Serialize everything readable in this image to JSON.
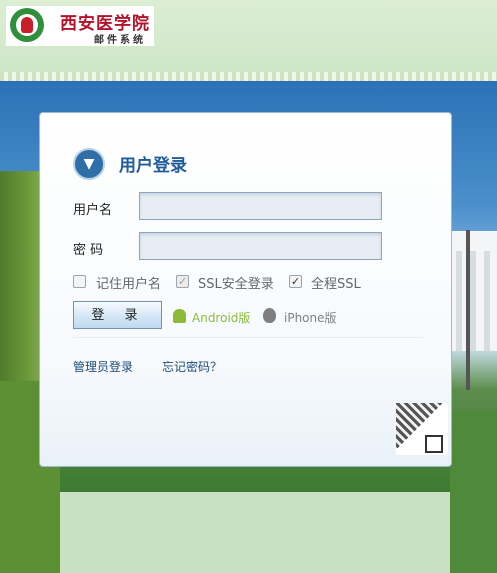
{
  "header": {
    "school_name": "西安医学院",
    "system_name": "邮件系统"
  },
  "login": {
    "title": "用户登录",
    "username_label": "用户名",
    "username_value": "",
    "password_label": "密 码",
    "password_value": "",
    "remember_label": "记住用户名",
    "remember_checked": false,
    "ssl_login_label": "SSL安全登录",
    "ssl_login_checked": true,
    "full_ssl_label": "全程SSL",
    "full_ssl_checked": true,
    "login_button": "登 录",
    "android_label": "Android版",
    "iphone_label": "iPhone版",
    "admin_login": "管理员登录",
    "forgot_password": "忘记密码？"
  },
  "colors": {
    "title_blue": "#1f5c9a",
    "logo_red": "#b3122a",
    "android_green": "#8cbb3c"
  },
  "icons": {
    "title": "arrow-down-circle-icon",
    "android": "android-icon",
    "apple": "apple-icon",
    "qr": "qr-code-icon"
  }
}
